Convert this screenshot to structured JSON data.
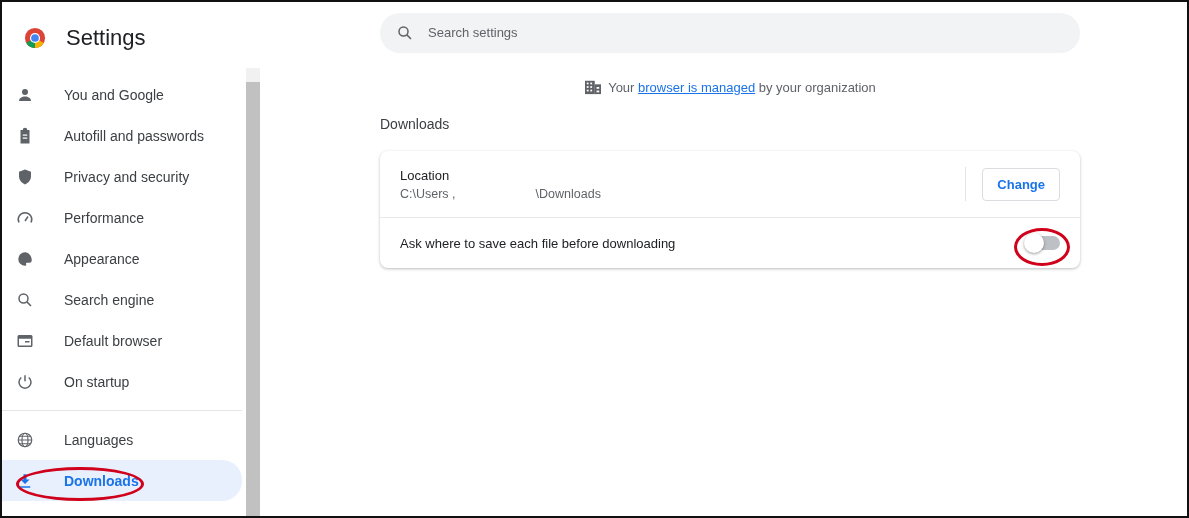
{
  "header": {
    "title": "Settings"
  },
  "search": {
    "placeholder": "Search settings"
  },
  "sidebar": {
    "items": [
      {
        "label": "You and Google",
        "selected": false
      },
      {
        "label": "Autofill and passwords",
        "selected": false
      },
      {
        "label": "Privacy and security",
        "selected": false
      },
      {
        "label": "Performance",
        "selected": false
      },
      {
        "label": "Appearance",
        "selected": false
      },
      {
        "label": "Search engine",
        "selected": false
      },
      {
        "label": "Default browser",
        "selected": false
      },
      {
        "label": "On startup",
        "selected": false
      },
      {
        "label": "Languages",
        "selected": false,
        "divider_before": true
      },
      {
        "label": "Downloads",
        "selected": true
      }
    ]
  },
  "managed_notice": {
    "before": "Your",
    "link": "browser is managed",
    "after": "by your organization"
  },
  "section": {
    "title": "Downloads",
    "location": {
      "label": "Location",
      "path_start": "C:\\Users ,",
      "path_end": "\\Downloads",
      "button": "Change"
    },
    "ask_toggle": {
      "label": "Ask where to save each file before downloading",
      "on": false
    }
  }
}
